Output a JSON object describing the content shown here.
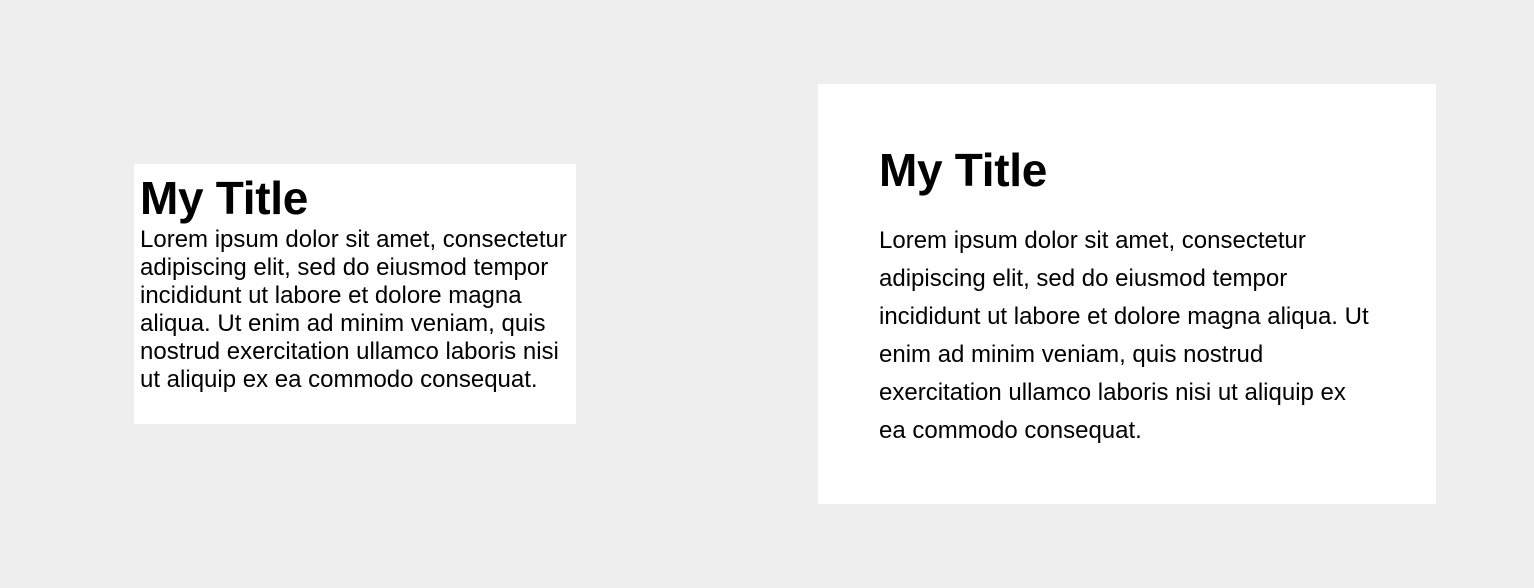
{
  "compact_card": {
    "title": "My Title",
    "body": "Lorem ipsum dolor sit amet, consectetur adipiscing elit, sed do eiusmod tempor incididunt ut labore et dolore magna aliqua. Ut enim ad minim veniam, quis nostrud exercitation ullamco laboris nisi ut aliquip ex ea commodo consequat."
  },
  "spacious_card": {
    "title": "My Title",
    "body": "Lorem ipsum dolor sit amet, consectetur adipiscing elit, sed do eiusmod tempor incididunt ut labore et dolore magna aliqua. Ut enim ad minim veniam, quis nostrud exercitation ullamco laboris nisi ut aliquip ex ea commodo consequat."
  },
  "colors": {
    "background": "#eeeeee",
    "card": "#ffffff",
    "text": "#000000"
  }
}
